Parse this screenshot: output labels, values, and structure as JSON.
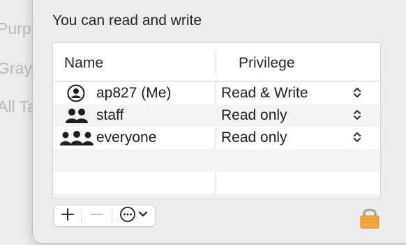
{
  "background_window": {
    "items": [
      "Purple",
      "Gray",
      "All Tags"
    ]
  },
  "sheet": {
    "permission_summary": "You can read and write",
    "table": {
      "columns": [
        "Name",
        "Privilege"
      ],
      "rows": [
        {
          "name": "ap827 (Me)",
          "privilege": "Read & Write",
          "icon": "single-user-icon"
        },
        {
          "name": "staff",
          "privilege": "Read only",
          "icon": "group-icon"
        },
        {
          "name": "everyone",
          "privilege": "Read only",
          "icon": "everyone-icon"
        }
      ]
    },
    "controls": {
      "add_icon": "plus-icon",
      "remove_icon": "minus-icon",
      "action_icon": "ellipsis-circle-icon",
      "menu_icon": "chevron-down-icon"
    },
    "lock_icon": "lock-icon",
    "colors": {
      "lock": "#f0a840",
      "row_alt": "#f4f4f4"
    }
  }
}
